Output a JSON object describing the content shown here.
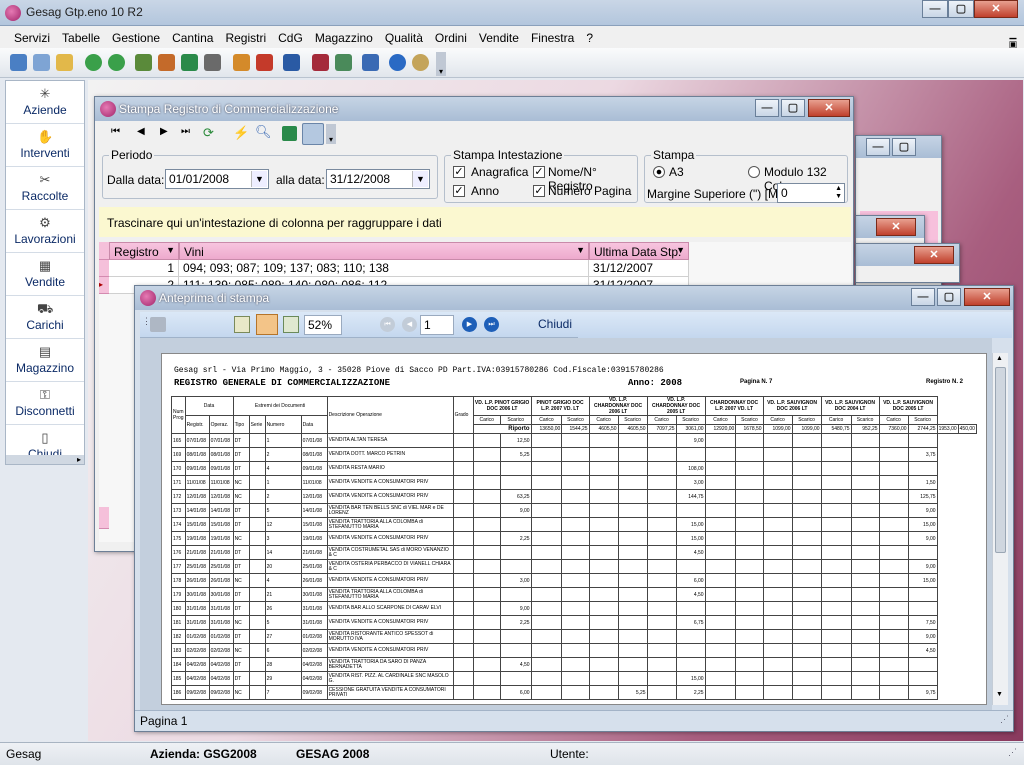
{
  "app": {
    "title": "Gesag Gtp.eno 10 R2"
  },
  "menu": [
    "Servizi",
    "Tabelle",
    "Gestione",
    "Cantina",
    "Registri",
    "CdG",
    "Magazzino",
    "Qualità",
    "Ordini",
    "Vendite",
    "Finestra",
    "?"
  ],
  "sidebar": [
    {
      "label": "Aziende",
      "icon": "building-icon"
    },
    {
      "label": "Interventi",
      "icon": "tools-icon"
    },
    {
      "label": "Raccolte",
      "icon": "harvest-icon"
    },
    {
      "label": "Lavorazioni",
      "icon": "processing-icon"
    },
    {
      "label": "Vendite",
      "icon": "sales-icon"
    },
    {
      "label": "Carichi",
      "icon": "truck-icon"
    },
    {
      "label": "Magazzino",
      "icon": "warehouse-icon"
    },
    {
      "label": "Disconnetti",
      "icon": "keys-icon"
    },
    {
      "label": "Chiudi",
      "icon": "door-icon"
    }
  ],
  "stampa": {
    "title": "Stampa Registro di Commercializzazione",
    "periodo": "Periodo",
    "dalla_label": "Dalla data:",
    "dalla_value": "01/01/2008",
    "alla_label": "alla data:",
    "alla_value": "31/12/2008",
    "intest_label": "Stampa Intestazione",
    "anagrafica": "Anagrafica",
    "nome": "Nome/N° Registro",
    "anno": "Anno",
    "numero_pagina": "Numero Pagina",
    "stampa_label": "Stampa",
    "a3": "A3",
    "modulo": "Modulo 132 Col.",
    "margine_label": "Margine Superiore (\") [M]:",
    "margine_value": "0",
    "group_hint": "Trascinare qui un'intestazione di colonna per raggruppare i dati",
    "cols": [
      "Registro",
      "Vini",
      "Ultima Data Stp."
    ],
    "rows": [
      {
        "registro": "1",
        "vini": "094; 093; 087; 109; 137; 083; 110; 138",
        "data": "31/12/2007"
      },
      {
        "registro": "2",
        "vini": "111; 139; 085; 089; 140; 080; 086; 112",
        "data": "31/12/2007"
      }
    ]
  },
  "preview": {
    "title": "Anteprima di stampa",
    "zoom": "52%",
    "page_number": "1",
    "close": "Chiudi",
    "status": "Pagina 1",
    "header_line": "Gesag srl - Via Primo Maggio, 3 - 35028 Piove di Sacco PD  Part.IVA:03915780286  Cod.Fiscale:03915780286",
    "reg_title": "REGISTRO GENERALE DI COMMERCIALIZZAZIONE",
    "anno": "Anno: 2008",
    "pagina": "Pagina N. 7",
    "registro": "Registro N. 2",
    "col_num": "Num Prog",
    "col_data": "Data",
    "col_estremi": "Estremi dei Documenti",
    "col_reg": "Registr.",
    "col_oper": "Operaz.",
    "col_tipo": "Tipo",
    "col_serie": "Serie",
    "col_numero": "Numero",
    "col_docdata": "Data",
    "col_descr": "Descrizione Operazione",
    "col_grado": "Grado",
    "riporto": "Riporto",
    "wines": [
      "VD. L.P. PINOT GRIGIO DOC 2006 LT",
      "PINOT GRIGIO DOC L.P. 2007 VD. LT",
      "VD. L.P. CHARDONNAY DOC 2006 LT",
      "VD. L.P. CHARDONNAY DOC 2005 LT",
      "CHARDONNAY DOC L.P. 2007 VD. LT",
      "VD. L.P. SAUVIGNON DOC 2006 LT",
      "VD. L.P. SAUVIGNON DOC 2004 LT",
      "VD. L.P. SAUVIGNON DOC 2005 LT"
    ],
    "carico": "Carico",
    "scarico": "Scarico",
    "riporto_vals": [
      "13650,00",
      "1544,25",
      "4605,50",
      "4605,50",
      "7097,25",
      "3061,00",
      "12920,00",
      "1678,50",
      "1099,00",
      "1099,00",
      "5480,75",
      "952,25",
      "7360,00",
      "2744,25",
      "1953,00",
      "450,00"
    ],
    "rows": [
      {
        "n": "165",
        "d1": "07/01/08",
        "d2": "07/01/08",
        "t": "DT",
        "s": "",
        "num": "1",
        "dd": "07/01/08",
        "desc": "VENDITA ALTAN TERESA",
        "v": [
          "",
          "12,50",
          "",
          "",
          "",
          "",
          "",
          "9,00",
          "",
          "",
          "",
          "",
          "",
          "",
          "",
          ""
        ]
      },
      {
        "n": "169",
        "d1": "08/01/08",
        "d2": "08/01/08",
        "t": "DT",
        "s": "",
        "num": "2",
        "dd": "08/01/08",
        "desc": "VENDITA DOTT. MARCO PETRIN",
        "v": [
          "",
          "5,25",
          "",
          "",
          "",
          "",
          "",
          "",
          "",
          "",
          "",
          "",
          "",
          "",
          "",
          "3,75"
        ]
      },
      {
        "n": "170",
        "d1": "09/01/08",
        "d2": "09/01/08",
        "t": "DT",
        "s": "",
        "num": "4",
        "dd": "09/01/08",
        "desc": "VENDITA RESTA MARIO",
        "v": [
          "",
          "",
          "",
          "",
          "",
          "",
          "",
          "108,00",
          "",
          "",
          "",
          "",
          "",
          "",
          "",
          ""
        ]
      },
      {
        "n": "171",
        "d1": "11/01/08",
        "d2": "11/01/08",
        "t": "NC",
        "s": "",
        "num": "1",
        "dd": "11/01/08",
        "desc": "VENDITA VENDITE A CONSUMATORI PRIV",
        "v": [
          "",
          "",
          "",
          "",
          "",
          "",
          "",
          "3,00",
          "",
          "",
          "",
          "",
          "",
          "",
          "",
          "1,50"
        ]
      },
      {
        "n": "172",
        "d1": "12/01/08",
        "d2": "12/01/08",
        "t": "NC",
        "s": "",
        "num": "2",
        "dd": "12/01/08",
        "desc": "VENDITA VENDITE A CONSUMATORI PRIV",
        "v": [
          "",
          "63,25",
          "",
          "",
          "",
          "",
          "",
          "144,75",
          "",
          "",
          "",
          "",
          "",
          "",
          "",
          "125,75"
        ]
      },
      {
        "n": "173",
        "d1": "14/01/08",
        "d2": "14/01/08",
        "t": "DT",
        "s": "",
        "num": "5",
        "dd": "14/01/08",
        "desc": "VENDITA BAR TEN BELLS SNC di VIEL MAR e DE LORENZ",
        "v": [
          "",
          "9,00",
          "",
          "",
          "",
          "",
          "",
          "",
          "",
          "",
          "",
          "",
          "",
          "",
          "",
          "9,00"
        ]
      },
      {
        "n": "174",
        "d1": "15/01/08",
        "d2": "15/01/08",
        "t": "DT",
        "s": "",
        "num": "12",
        "dd": "15/01/08",
        "desc": "VENDITA TRATTORIA ALLA COLOMBA di STEFANUTTO MARIA",
        "v": [
          "",
          "",
          "",
          "",
          "",
          "",
          "",
          "15,00",
          "",
          "",
          "",
          "",
          "",
          "",
          "",
          "15,00"
        ]
      },
      {
        "n": "175",
        "d1": "19/01/08",
        "d2": "19/01/08",
        "t": "NC",
        "s": "",
        "num": "3",
        "dd": "19/01/08",
        "desc": "VENDITA VENDITE A CONSUMATORI PRIV",
        "v": [
          "",
          "2,25",
          "",
          "",
          "",
          "",
          "",
          "15,00",
          "",
          "",
          "",
          "",
          "",
          "",
          "",
          "9,00"
        ]
      },
      {
        "n": "176",
        "d1": "21/01/08",
        "d2": "21/01/08",
        "t": "DT",
        "s": "",
        "num": "14",
        "dd": "21/01/08",
        "desc": "VENDITA COSTRUMETAL SAS di MORO VENANZIO & C",
        "v": [
          "",
          "",
          "",
          "",
          "",
          "",
          "",
          "4,50",
          "",
          "",
          "",
          "",
          "",
          "",
          "",
          ""
        ]
      },
      {
        "n": "177",
        "d1": "25/01/08",
        "d2": "25/01/08",
        "t": "DT",
        "s": "",
        "num": "20",
        "dd": "25/01/08",
        "desc": "VENDITA OSTERIA PERBACCO DI VIANELL CHIARA & C",
        "v": [
          "",
          "",
          "",
          "",
          "",
          "",
          "",
          "",
          "",
          "",
          "",
          "",
          "",
          "",
          "",
          "9,00"
        ]
      },
      {
        "n": "178",
        "d1": "26/01/08",
        "d2": "26/01/08",
        "t": "NC",
        "s": "",
        "num": "4",
        "dd": "26/01/08",
        "desc": "VENDITA VENDITE A CONSUMATORI PRIV",
        "v": [
          "",
          "3,00",
          "",
          "",
          "",
          "",
          "",
          "6,00",
          "",
          "",
          "",
          "",
          "",
          "",
          "",
          "15,00"
        ]
      },
      {
        "n": "179",
        "d1": "30/01/08",
        "d2": "30/01/08",
        "t": "DT",
        "s": "",
        "num": "21",
        "dd": "30/01/08",
        "desc": "VENDITA TRATTORIA ALLA COLOMBA di STEFANUTTO MARIA",
        "v": [
          "",
          "",
          "",
          "",
          "",
          "",
          "",
          "4,50",
          "",
          "",
          "",
          "",
          "",
          "",
          "",
          ""
        ]
      },
      {
        "n": "180",
        "d1": "31/01/08",
        "d2": "31/01/08",
        "t": "DT",
        "s": "",
        "num": "26",
        "dd": "31/01/08",
        "desc": "VENDITA BAR ALLO SCARPONE DI CARAV ELVI",
        "v": [
          "",
          "9,00",
          "",
          "",
          "",
          "",
          "",
          "",
          "",
          "",
          "",
          "",
          "",
          "",
          "",
          ""
        ]
      },
      {
        "n": "181",
        "d1": "31/01/08",
        "d2": "31/01/08",
        "t": "NC",
        "s": "",
        "num": "5",
        "dd": "31/01/08",
        "desc": "VENDITA VENDITE A CONSUMATORI PRIV",
        "v": [
          "",
          "2,25",
          "",
          "",
          "",
          "",
          "",
          "6,75",
          "",
          "",
          "",
          "",
          "",
          "",
          "",
          "7,50"
        ]
      },
      {
        "n": "182",
        "d1": "01/02/08",
        "d2": "01/02/08",
        "t": "DT",
        "s": "",
        "num": "27",
        "dd": "01/02/08",
        "desc": "VENDITA RISTORANTE ANTICO SPESSOT di MORUTTO IVA",
        "v": [
          "",
          "",
          "",
          "",
          "",
          "",
          "",
          "",
          "",
          "",
          "",
          "",
          "",
          "",
          "",
          "9,00"
        ]
      },
      {
        "n": "183",
        "d1": "02/02/08",
        "d2": "02/02/08",
        "t": "NC",
        "s": "",
        "num": "6",
        "dd": "02/02/08",
        "desc": "VENDITA VENDITE A CONSUMATORI PRIV",
        "v": [
          "",
          "",
          "",
          "",
          "",
          "",
          "",
          "",
          "",
          "",
          "",
          "",
          "",
          "",
          "",
          "4,50"
        ]
      },
      {
        "n": "184",
        "d1": "04/02/08",
        "d2": "04/02/08",
        "t": "DT",
        "s": "",
        "num": "28",
        "dd": "04/02/08",
        "desc": "VENDITA TRATTORIA DA SARO DI PANZA BERNADETTA",
        "v": [
          "",
          "4,50",
          "",
          "",
          "",
          "",
          "",
          "",
          "",
          "",
          "",
          "",
          "",
          "",
          "",
          ""
        ]
      },
      {
        "n": "185",
        "d1": "04/02/08",
        "d2": "04/02/08",
        "t": "DT",
        "s": "",
        "num": "29",
        "dd": "04/02/08",
        "desc": "VENDITA RIST. PIZZ. AL CARDINALE SNC MASOLO G.",
        "v": [
          "",
          "",
          "",
          "",
          "",
          "",
          "",
          "15,00",
          "",
          "",
          "",
          "",
          "",
          "",
          "",
          ""
        ]
      },
      {
        "n": "186",
        "d1": "09/02/08",
        "d2": "09/02/08",
        "t": "NC",
        "s": "",
        "num": "7",
        "dd": "09/02/08",
        "desc": "CESSIONE GRATUITA VENDITE A CONSUMATORI PRIVATI",
        "v": [
          "",
          "6,00",
          "",
          "",
          "",
          "5,25",
          "",
          "2,25",
          "",
          "",
          "",
          "",
          "",
          "",
          "",
          "9,75"
        ]
      }
    ]
  },
  "status": {
    "app": "Gesag",
    "azienda": "Azienda: GSG2008",
    "anno": "GESAG 2008",
    "utente": "Utente:"
  }
}
